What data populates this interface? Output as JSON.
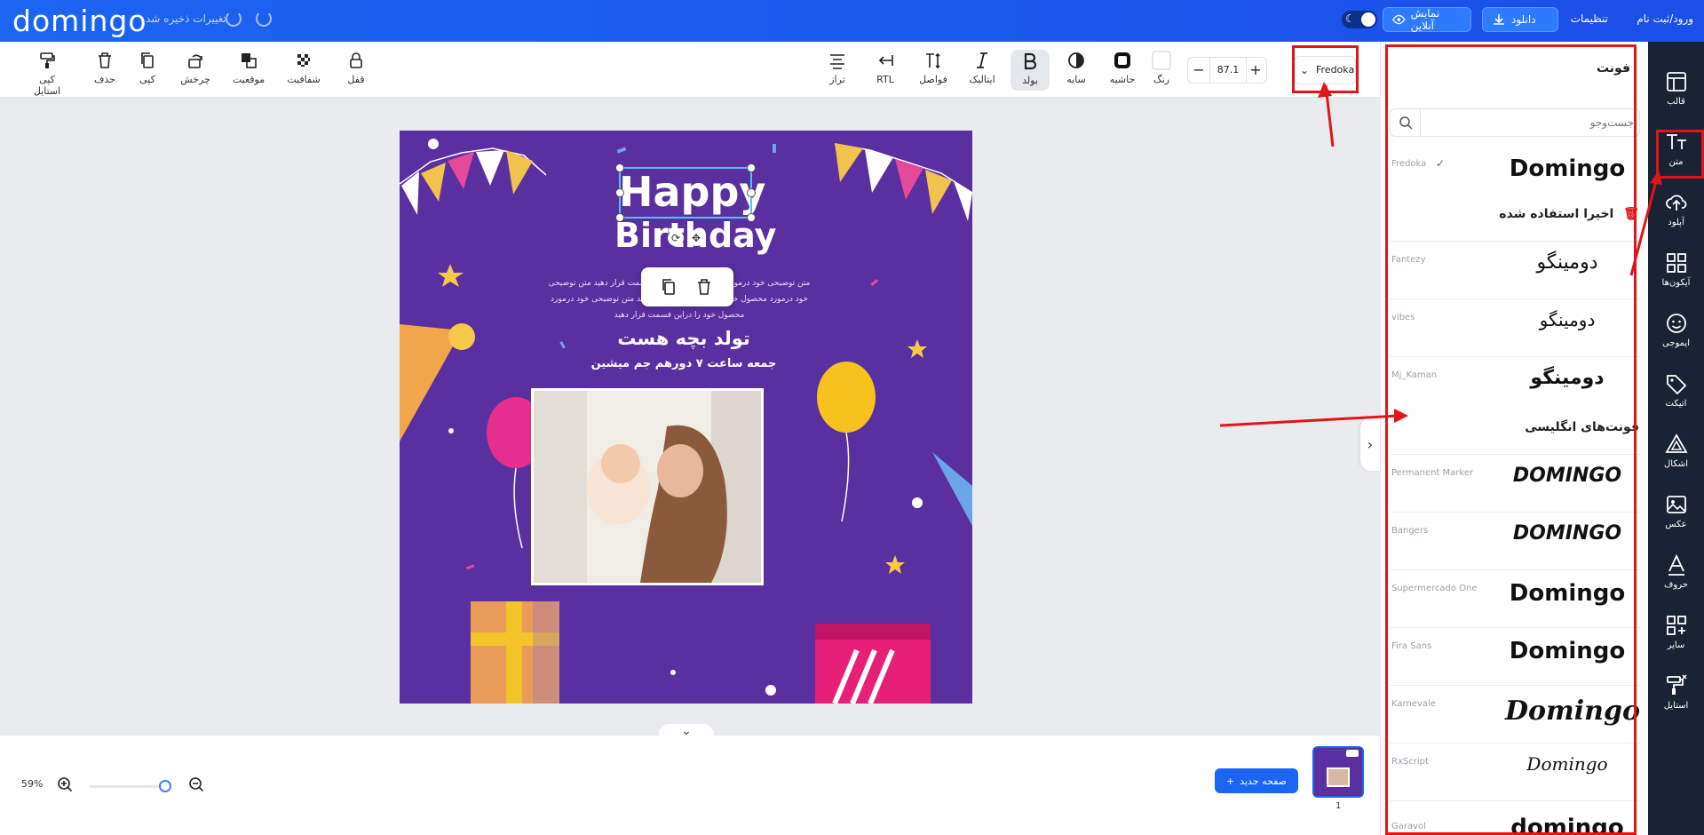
{
  "topbar": {
    "logo": "domingo",
    "saved_status": "تغییرات ذخیره شد",
    "login": "ورود/ثبت نام",
    "settings": "تنظیمات",
    "download": "دانلود",
    "preview": "نمایش آنلاین"
  },
  "toolbar": {
    "left_tools": [
      {
        "label": "کپی استایل",
        "icon": "paint-roller-icon"
      },
      {
        "label": "حذف",
        "icon": "trash-icon"
      },
      {
        "label": "کپی",
        "icon": "copy-icon"
      },
      {
        "label": "چرخش",
        "icon": "rotate-icon"
      },
      {
        "label": "موقعیت",
        "icon": "layers-icon"
      },
      {
        "label": "شفافیت",
        "icon": "transparency-icon"
      },
      {
        "label": "قفل",
        "icon": "lock-icon"
      }
    ],
    "right_tools": [
      {
        "label": "تراز",
        "icon": "align-center-icon"
      },
      {
        "label": "RTL",
        "icon": "rtl-icon"
      },
      {
        "label": "فواصل",
        "icon": "spacing-icon"
      },
      {
        "label": "ایتالیک",
        "icon": "italic-icon"
      },
      {
        "label": "بولد",
        "icon": "bold-icon"
      },
      {
        "label": "سایه",
        "icon": "shadow-icon"
      },
      {
        "label": "حاشیه",
        "icon": "border-icon"
      },
      {
        "label": "رنگ",
        "icon": "color-icon"
      }
    ],
    "font_size": "87.1",
    "font_name": "Fredoka"
  },
  "panel": {
    "title": "فونت",
    "search_placeholder": "جست‌وجو",
    "recent_heading": "اخیرا استفاده شده",
    "english_heading": "فونت‌های انگلیسی",
    "fonts": [
      {
        "name": "Fredoka",
        "sample": "Domingo",
        "checked": "✓"
      },
      {
        "name": "Fantezy",
        "sample": "دومینگو"
      },
      {
        "name": "vibes",
        "sample": "دومینگو"
      },
      {
        "name": "Mj_Kaman",
        "sample": "دومینگو"
      },
      {
        "name": "Permanent Marker",
        "sample": "DOMINGO"
      },
      {
        "name": "Bangers",
        "sample": "DOMINGO"
      },
      {
        "name": "Supermercado One",
        "sample": "Domingo"
      },
      {
        "name": "Fira Sans",
        "sample": "Domingo"
      },
      {
        "name": "Karnevale",
        "sample": "Domingo"
      },
      {
        "name": "RxScript",
        "sample": "Domingo"
      },
      {
        "name": "Garavol",
        "sample": "domingo"
      }
    ]
  },
  "nav": [
    {
      "label": "قالب",
      "icon": "template-icon"
    },
    {
      "label": "متن",
      "icon": "text-icon"
    },
    {
      "label": "آپلود",
      "icon": "upload-icon"
    },
    {
      "label": "آیکون‌ها",
      "icon": "grid-icon"
    },
    {
      "label": "ایموجی",
      "icon": "emoji-icon"
    },
    {
      "label": "اتیکت",
      "icon": "tag-icon"
    },
    {
      "label": "اشکال",
      "icon": "shapes-icon"
    },
    {
      "label": "عکس",
      "icon": "image-icon"
    },
    {
      "label": "حروف",
      "icon": "letter-icon"
    },
    {
      "label": "سایر",
      "icon": "more-icon"
    },
    {
      "label": "استایل",
      "icon": "style-icon"
    }
  ],
  "artboard": {
    "heading_line1": "Happy",
    "heading_line2": "Birthday",
    "description": "متن توضیحی خود درمورد محصول خود را دراین قسمت قرار دهید متن توضیحی خود درمورد محصول خود را دراین قسمت قرار دهید متن توضیحی خود درمورد محصول خود را دراین قسمت قرار دهید",
    "title": "تولد بچه هست",
    "subtitle": "جمعه ساعت ۷ دورهم جم میشین"
  },
  "bottom": {
    "zoom": "59%",
    "new_page": "صفحه جدید",
    "page_number": "1"
  },
  "colors": {
    "primary": "#1c64f2",
    "artboard_bg": "#5a2fa0",
    "annotation": "#e2141b"
  }
}
